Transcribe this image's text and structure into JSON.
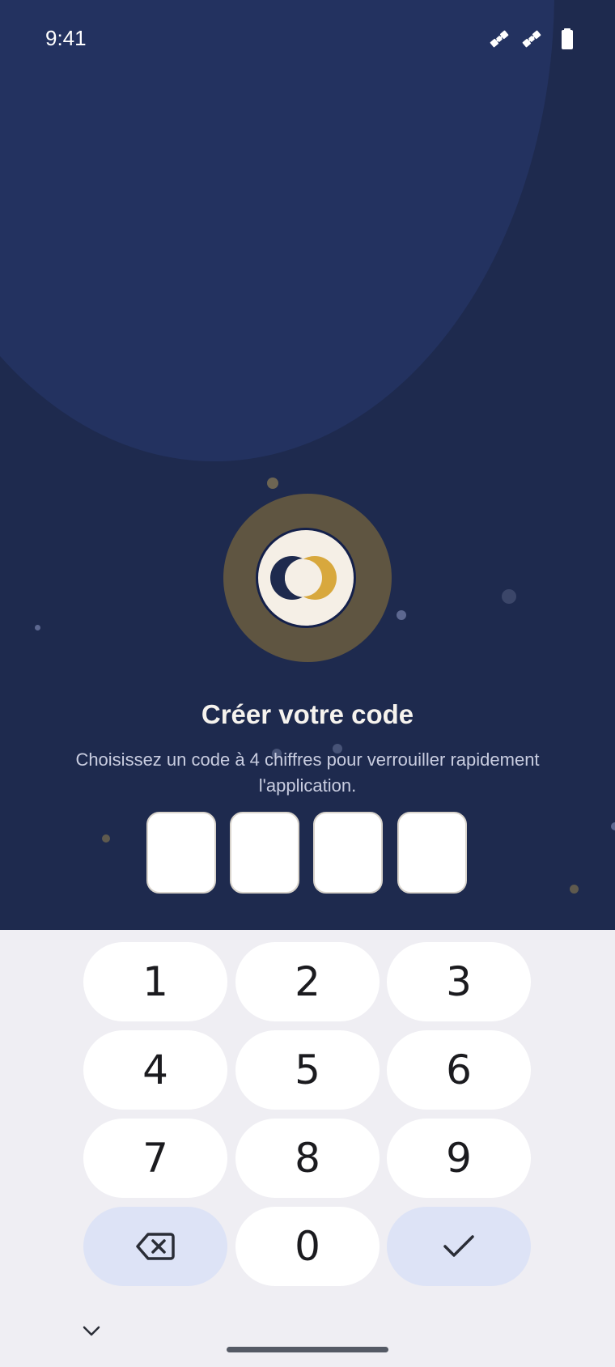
{
  "status_bar": {
    "time": "9:41",
    "icons": [
      "satellite-icon",
      "satellite-icon",
      "battery-icon"
    ]
  },
  "logo": {
    "icon": "moon-logo-icon",
    "colors": {
      "ring": "#5f5541",
      "navy": "#1e2a4e",
      "gold": "#d8a83d",
      "cream": "#f5efe6"
    }
  },
  "header": {
    "title": "Créer votre code",
    "subtitle_line1": "Choisissez un code à 4 chiffres pour verrouiller rapidement",
    "subtitle_line2": "l'application."
  },
  "pin": {
    "length": 4,
    "digits": [
      "",
      "",
      "",
      ""
    ]
  },
  "keypad": {
    "keys": [
      "1",
      "2",
      "3",
      "4",
      "5",
      "6",
      "7",
      "8",
      "9"
    ],
    "zero": "0",
    "backspace_icon": "backspace-icon",
    "confirm_icon": "checkmark-icon",
    "collapse_icon": "chevron-down-icon"
  },
  "colors": {
    "background": "#1e2a4e",
    "keyboard": "#efeef3",
    "action_key": "#dde3f6"
  }
}
